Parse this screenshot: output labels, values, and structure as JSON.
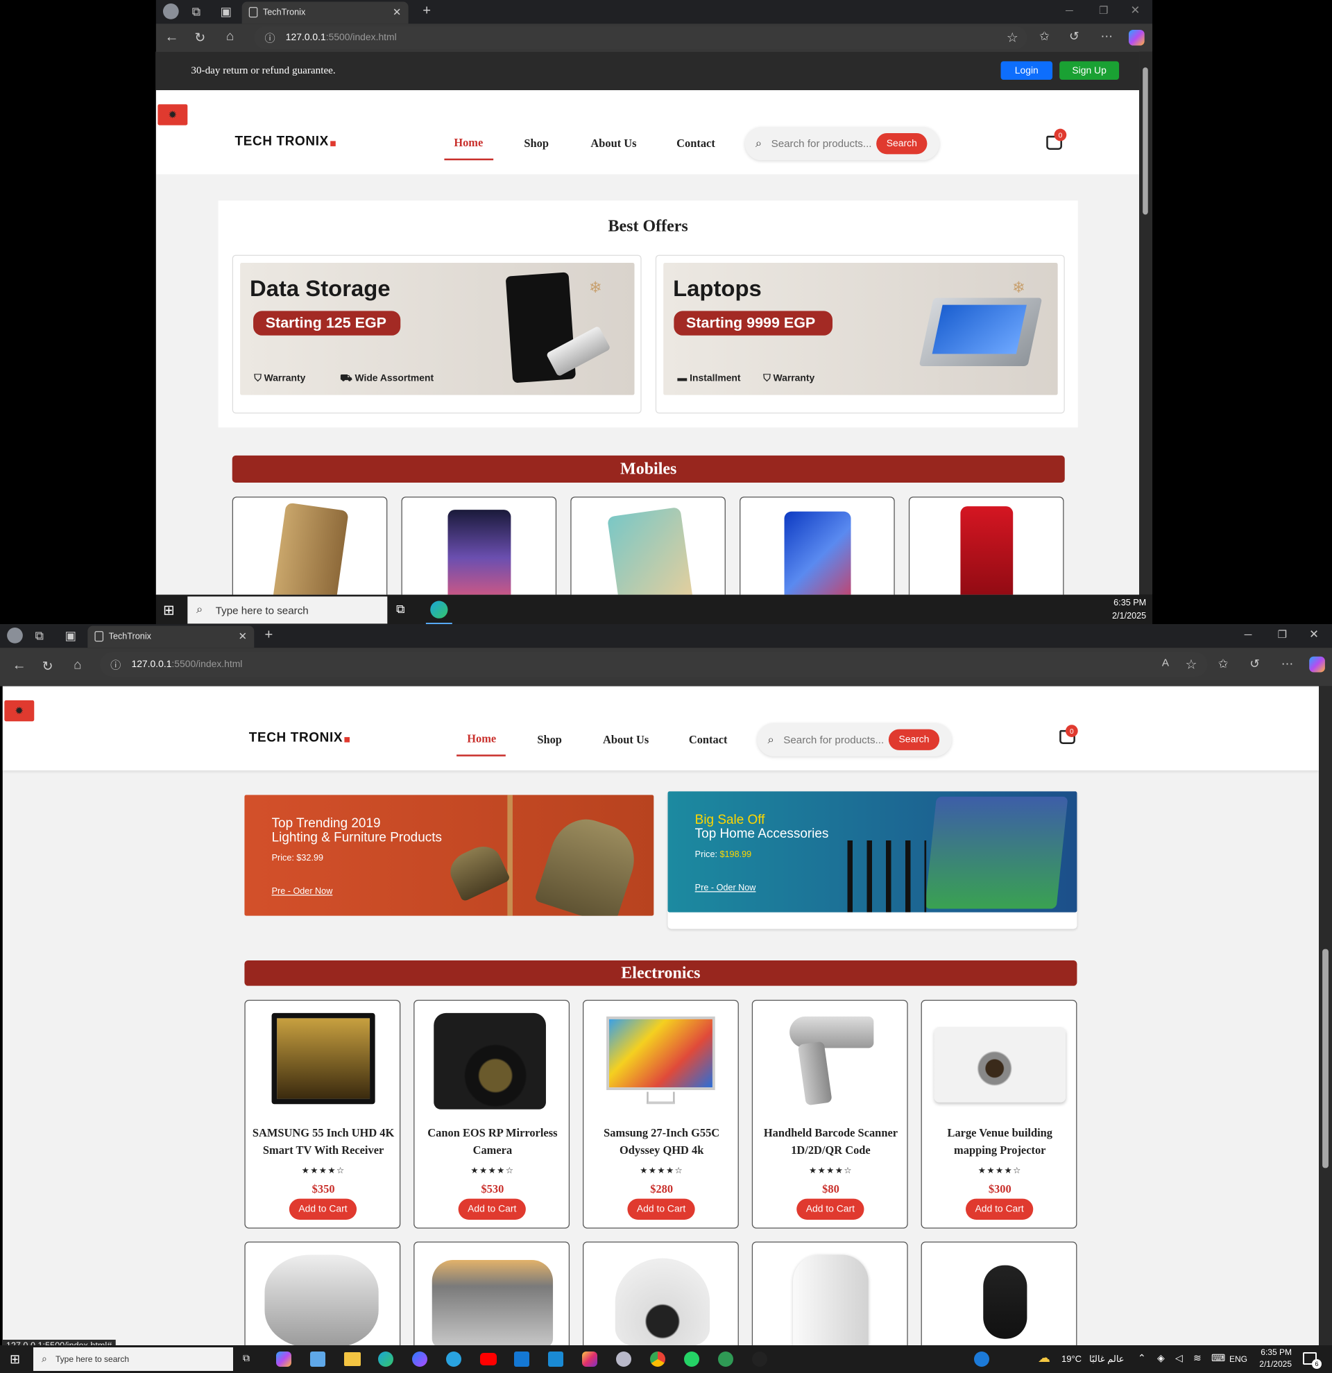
{
  "window1": {
    "tab_title": "TechTronix",
    "url_host": "127.0.0.1",
    "url_rest": ":5500/index.html",
    "promo": "30-day return or refund guarantee.",
    "login": "Login",
    "signup": "Sign Up"
  },
  "window2": {
    "tab_title": "TechTronix",
    "url_host": "127.0.0.1",
    "url_rest": ":5500/index.html",
    "status_url": "127.0.0.1:5500/index.html#"
  },
  "brand": {
    "name": "TECH TRONIX"
  },
  "nav": {
    "home": "Home",
    "shop": "Shop",
    "about": "About Us",
    "contact": "Contact"
  },
  "search": {
    "placeholder": "Search for products...",
    "button": "Search"
  },
  "cart": {
    "count": "0"
  },
  "offers": {
    "heading": "Best Offers",
    "items": [
      {
        "title": "Data Storage",
        "pill_prefix": "Starting",
        "pill_value": "125 EGP",
        "feat1": "Warranty",
        "feat2": "Wide Assortment"
      },
      {
        "title": "Laptops",
        "pill_prefix": "Starting",
        "pill_value": "9999 EGP",
        "feat1": "Installment",
        "feat2": "Warranty"
      }
    ]
  },
  "mobiles": {
    "heading": "Mobiles"
  },
  "banners": [
    {
      "line1": "Top Trending 2019",
      "line2": "Lighting & Furniture Products",
      "price_label": "Price:",
      "price": "$32.99",
      "cta": "Pre - Oder Now"
    },
    {
      "line1": "Big Sale Off",
      "line2": "Top Home Accessories",
      "price_label": "Price:",
      "price": "$198.99",
      "cta": "Pre - Oder Now"
    }
  ],
  "electronics": {
    "heading": "Electronics",
    "products": [
      {
        "name": "SAMSUNG 55 Inch UHD 4K Smart TV With Receiver",
        "stars": "★★★★☆",
        "price": "$350",
        "cta": "Add to Cart"
      },
      {
        "name": "Canon EOS RP Mirrorless Camera",
        "stars": "★★★★☆",
        "price": "$530",
        "cta": "Add to Cart"
      },
      {
        "name": "Samsung 27-Inch G55C Odyssey QHD 4k",
        "stars": "★★★★☆",
        "price": "$280",
        "cta": "Add to Cart"
      },
      {
        "name": "Handheld Barcode Scanner 1D/2D/QR Code",
        "stars": "★★★★☆",
        "price": "$80",
        "cta": "Add to Cart"
      },
      {
        "name": "Large Venue building mapping Projector",
        "stars": "★★★★☆",
        "price": "$300",
        "cta": "Add to Cart"
      }
    ]
  },
  "taskbar": {
    "search_placeholder": "Type here to search",
    "time": "6:35 PM",
    "date": "2/1/2025",
    "weather": "19°C",
    "weather_text": "عالم غالبًا",
    "lang": "ENG",
    "notif": "6"
  },
  "colors": {
    "accent": "#e03a2f",
    "section": "#98261e",
    "login": "#0d6efd",
    "signup": "#1aa133"
  }
}
